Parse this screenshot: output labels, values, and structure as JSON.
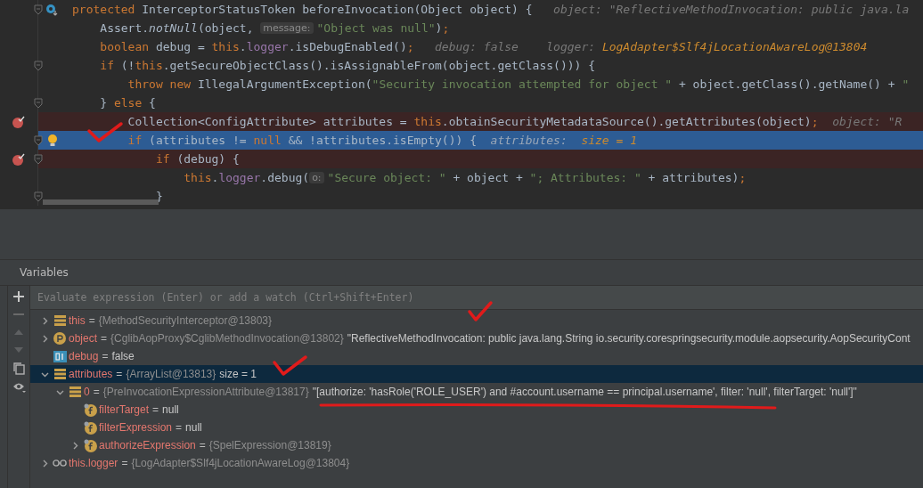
{
  "editor": {
    "lines": [
      {
        "segments": [
          {
            "kind": "kw",
            "t": "protected "
          },
          {
            "kind": "plain",
            "t": "InterceptorStatusToken beforeInvocation(Object object) {"
          },
          {
            "kind": "hint",
            "t": "   object: \"ReflectiveMethodInvocation: public java.la"
          }
        ],
        "breakpoint": false,
        "current": false,
        "fold": true,
        "marker": {
          "kind": "override"
        }
      },
      {
        "segments": [
          {
            "kind": "plain",
            "t": "    Assert."
          },
          {
            "kind": "italic",
            "t": "notNull"
          },
          {
            "kind": "plain",
            "t": "(object, "
          },
          {
            "kind": "param",
            "t": "message:"
          },
          {
            "kind": "str",
            "t": "\"Object was null\""
          },
          {
            "kind": "plain",
            "t": ")"
          },
          {
            "kind": "kw",
            "t": ";"
          }
        ],
        "breakpoint": false,
        "current": false,
        "fold": false
      },
      {
        "segments": [
          {
            "kind": "kw",
            "t": "    boolean "
          },
          {
            "kind": "plain",
            "t": "debug = "
          },
          {
            "kind": "kw",
            "t": "this"
          },
          {
            "kind": "plain",
            "t": "."
          },
          {
            "kind": "field",
            "t": "logger"
          },
          {
            "kind": "plain",
            "t": ".isDebugEnabled()"
          },
          {
            "kind": "kw",
            "t": ";"
          },
          {
            "kind": "hint",
            "t": "   debug: false    logger: "
          },
          {
            "kind": "hintval",
            "t": "LogAdapter$Slf4jLocationAwareLog@13804"
          }
        ],
        "breakpoint": false,
        "current": false,
        "fold": false
      },
      {
        "segments": [
          {
            "kind": "kw",
            "t": "    if "
          },
          {
            "kind": "plain",
            "t": "(!"
          },
          {
            "kind": "kw",
            "t": "this"
          },
          {
            "kind": "plain",
            "t": ".getSecureObjectClass().isAssignableFrom(object.getClass())) {"
          }
        ],
        "breakpoint": false,
        "current": false,
        "fold": true
      },
      {
        "segments": [
          {
            "kind": "kw",
            "t": "        throw new "
          },
          {
            "kind": "plain",
            "t": "IllegalArgumentException("
          },
          {
            "kind": "str",
            "t": "\"Security invocation attempted for object \""
          },
          {
            "kind": "plain",
            "t": " + object.getClass().getName() + "
          },
          {
            "kind": "str",
            "t": "\""
          }
        ],
        "breakpoint": false,
        "current": false,
        "fold": false
      },
      {
        "segments": [
          {
            "kind": "plain",
            "t": "    } "
          },
          {
            "kind": "kw",
            "t": "else "
          },
          {
            "kind": "plain",
            "t": "{"
          }
        ],
        "breakpoint": false,
        "current": false,
        "fold": true
      },
      {
        "segments": [
          {
            "kind": "plain",
            "t": "        Collection<ConfigAttribute> attributes = "
          },
          {
            "kind": "kw",
            "t": "this"
          },
          {
            "kind": "plain",
            "t": ".obtainSecurityMetadataSource().getAttributes(object)"
          },
          {
            "kind": "kw",
            "t": ";"
          },
          {
            "kind": "hint",
            "t": "  object: \"R"
          }
        ],
        "breakpoint": true,
        "current": false,
        "fold": false
      },
      {
        "segments": [
          {
            "kind": "kw",
            "t": "        if "
          },
          {
            "kind": "plain",
            "t": "(attributes != "
          },
          {
            "kind": "kw",
            "t": "null "
          },
          {
            "kind": "plain",
            "t": "&& !attributes.isEmpty()) {"
          },
          {
            "kind": "hint",
            "t": "  attributes:  "
          },
          {
            "kind": "hintval",
            "t": "size = 1"
          }
        ],
        "breakpoint": false,
        "current": true,
        "fold": true,
        "marker": {
          "kind": "bulb"
        }
      },
      {
        "segments": [
          {
            "kind": "kw",
            "t": "            if "
          },
          {
            "kind": "plain",
            "t": "(debug) {"
          }
        ],
        "breakpoint": true,
        "current": false,
        "fold": true
      },
      {
        "segments": [
          {
            "kind": "kw",
            "t": "                this"
          },
          {
            "kind": "plain",
            "t": "."
          },
          {
            "kind": "field",
            "t": "logger"
          },
          {
            "kind": "plain",
            "t": ".debug("
          },
          {
            "kind": "param",
            "t": "o:"
          },
          {
            "kind": "str",
            "t": "\"Secure object: \""
          },
          {
            "kind": "plain",
            "t": " + object + "
          },
          {
            "kind": "str",
            "t": "\"; Attributes: \""
          },
          {
            "kind": "plain",
            "t": " + attributes)"
          },
          {
            "kind": "kw",
            "t": ";"
          }
        ],
        "breakpoint": false,
        "current": false,
        "fold": false
      },
      {
        "segments": [
          {
            "kind": "plain",
            "t": "            }"
          }
        ],
        "breakpoint": false,
        "current": false,
        "fold": true
      }
    ]
  },
  "variables": {
    "title": "Variables",
    "evaluate": {
      "placeholder": "Evaluate expression (Enter) or add a watch (Ctrl+Shift+Enter)"
    },
    "tree": [
      {
        "kind": "list",
        "name": "this",
        "sep": "=",
        "ref": "{MethodSecurityInterceptor@13803}",
        "expanded": false,
        "selected": false
      },
      {
        "kind": "param",
        "name": "object",
        "sep": "=",
        "ref": "{CglibAopProxy$CglibMethodInvocation@13802}",
        "value": "\"ReflectiveMethodInvocation: public java.lang.String io.security.corespringsecurity.module.aopsecurity.AopSecurityCont",
        "expanded": false,
        "selected": false
      },
      {
        "kind": "primitive",
        "name": "debug",
        "sep": "=",
        "value": "false",
        "selected": false
      },
      {
        "kind": "list",
        "name": "attributes",
        "sep": "=",
        "ref": "{ArrayList@13813}",
        "value": " size = 1",
        "expanded": true,
        "selected": true,
        "children": [
          {
            "kind": "list",
            "name": "0",
            "sep": "=",
            "ref": "{PreInvocationExpressionAttribute@13817}",
            "value": "\"[authorize: 'hasRole('ROLE_USER') and #account.username == principal.username', filter: 'null', filterTarget: 'null']\"",
            "expanded": true,
            "selected": false,
            "children": [
              {
                "kind": "field",
                "name": "filterTarget",
                "sep": "=",
                "value": "null",
                "selected": false
              },
              {
                "kind": "field",
                "name": "filterExpression",
                "sep": "=",
                "value": "null",
                "selected": false
              },
              {
                "kind": "field",
                "name": "authorizeExpression",
                "sep": "=",
                "ref": "{SpelExpression@13819}",
                "expanded": false,
                "selected": false
              }
            ]
          }
        ]
      },
      {
        "kind": "watch",
        "name": "this.logger",
        "sep": "=",
        "ref": "{LogAdapter$Slf4jLocationAwareLog@13804}",
        "expanded": false,
        "selected": false
      }
    ]
  }
}
